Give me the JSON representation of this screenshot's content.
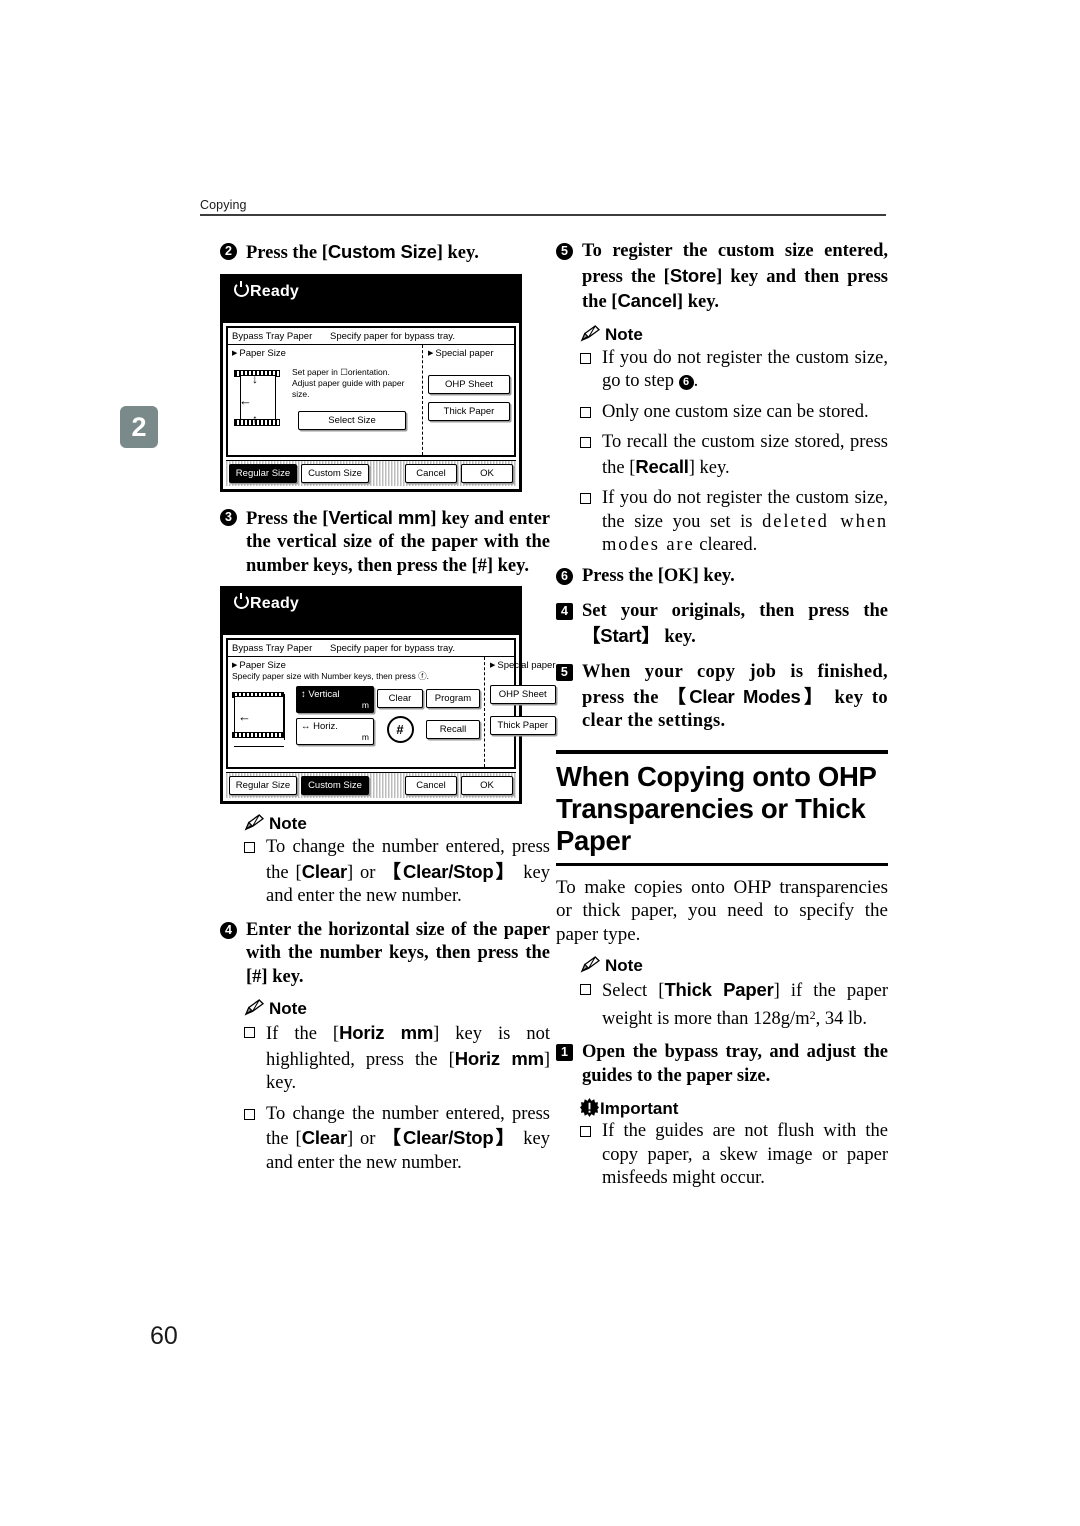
{
  "page": {
    "running_head": "Copying",
    "chapter_tab": "2",
    "folio": "60"
  },
  "left_column": {
    "step2": {
      "bullet": "2",
      "text_before": "Press the [",
      "key": "Custom Size",
      "text_after": "] key."
    },
    "lcd1": {
      "status": "Ready",
      "title_left": "Bypass Tray Paper",
      "title_right": "Specify paper for bypass tray.",
      "section_left": "Paper Size",
      "section_right": "Special paper",
      "hint_line1": "Set paper in ☐orientation.",
      "hint_line2": "Adjust paper guide with paper size.",
      "select_size_btn": "Select Size",
      "ohp_btn": "OHP Sheet",
      "thick_btn": "Thick Paper",
      "footer": {
        "regular": "Regular Size",
        "custom": "Custom Size",
        "cancel": "Cancel",
        "ok": "OK",
        "selected": "Regular Size"
      }
    },
    "step3": {
      "bullet": "3",
      "line1_a": "Press the [",
      "line1_key": "Vertical mm",
      "line1_b": "] key and enter the vertical size of the paper with the number keys, then press the [#] key."
    },
    "lcd2": {
      "status": "Ready",
      "title_left": "Bypass Tray Paper",
      "title_right": "Specify paper for bypass tray.",
      "section_left": "Paper Size",
      "section_right": "Special paper",
      "hint_line1": "Specify paper size with Number keys, then press ⓕ.",
      "vertical_btn": "Vertical",
      "vertical_unit": "m",
      "horiz_btn": "Horiz.",
      "horiz_unit": "m",
      "clear_btn": "Clear",
      "program_btn": "Program",
      "recall_btn": "Recall",
      "hash_btn": "#",
      "ohp_btn": "OHP Sheet",
      "thick_btn": "Thick Paper",
      "footer": {
        "regular": "Regular Size",
        "custom": "Custom Size",
        "cancel": "Cancel",
        "ok": "OK",
        "selected": "Custom Size"
      }
    },
    "note1": {
      "heading": "Note",
      "items": [
        {
          "a": "To change the number entered, press the [",
          "k1": "Clear",
          "b": "] or ",
          "k2": "【Clear/Stop】",
          "c": " key and enter the new number."
        }
      ]
    },
    "step4": {
      "bullet": "4",
      "text": "Enter the horizontal size of the paper with the number keys, then press the [#] key."
    },
    "note2": {
      "heading": "Note",
      "items": [
        {
          "a": "If the [",
          "k1": "Horiz mm",
          "b": "] key is not highlighted, press the [",
          "k2": "Horiz mm",
          "c": "] key."
        },
        {
          "a": "To change the number entered, press the [",
          "k1": "Clear",
          "b": "] or ",
          "k2": "【Clear/Stop】",
          "c": " key and enter the new number."
        }
      ]
    }
  },
  "right_column": {
    "step5": {
      "bullet": "5",
      "a": "To register the custom size entered, press the [",
      "k1": "Store",
      "b": "] key and then press the [",
      "k2": "Cancel",
      "c": "] key."
    },
    "note3": {
      "heading": "Note",
      "item1_a": "If you do not register the custom size, go to step ",
      "item1_ref": "6",
      "item1_b": ".",
      "item2": "Only one custom size can be stored.",
      "item3_a": "To recall the custom size stored, press the [",
      "item3_k": "Recall",
      "item3_b": "] key.",
      "item4_a": "If you do not register the custom size, the size you set is ",
      "item4_loose": "deleted when modes are",
      "item4_b": " cleared."
    },
    "step6": {
      "bullet": "6",
      "text": "Press the [OK] key."
    },
    "step4main": {
      "bullet": "4",
      "a": "Set your originals, then press the ",
      "k": "【Start】",
      "b": " key."
    },
    "step5main": {
      "bullet": "5",
      "a": "When your copy job is finished, press the ",
      "k": "【Clear Modes】",
      "b": " key to clear the settings."
    },
    "section": {
      "title_line1": "When Copying onto OHP",
      "title_line2": "Transparencies or Thick Paper",
      "intro": "To make copies onto OHP transparencies or thick paper, you need to specify the paper type."
    },
    "note4": {
      "heading": "Note",
      "item_a": "Select [",
      "item_k": "Thick Paper",
      "item_b": "] if the paper weight is more than 128g/m",
      "item_sup": "2",
      "item_c": ", 34 lb."
    },
    "step1main": {
      "bullet": "1",
      "text": "Open the bypass tray, and adjust the guides to the paper size."
    },
    "important": {
      "heading": "Important",
      "item": "If the guides are not flush with the copy paper, a skew image or paper misfeeds might occur."
    }
  },
  "colors": {
    "chapter_tab_bg": "#7a8a8a",
    "rule": "#3d3d3d",
    "ink": "#000000"
  }
}
